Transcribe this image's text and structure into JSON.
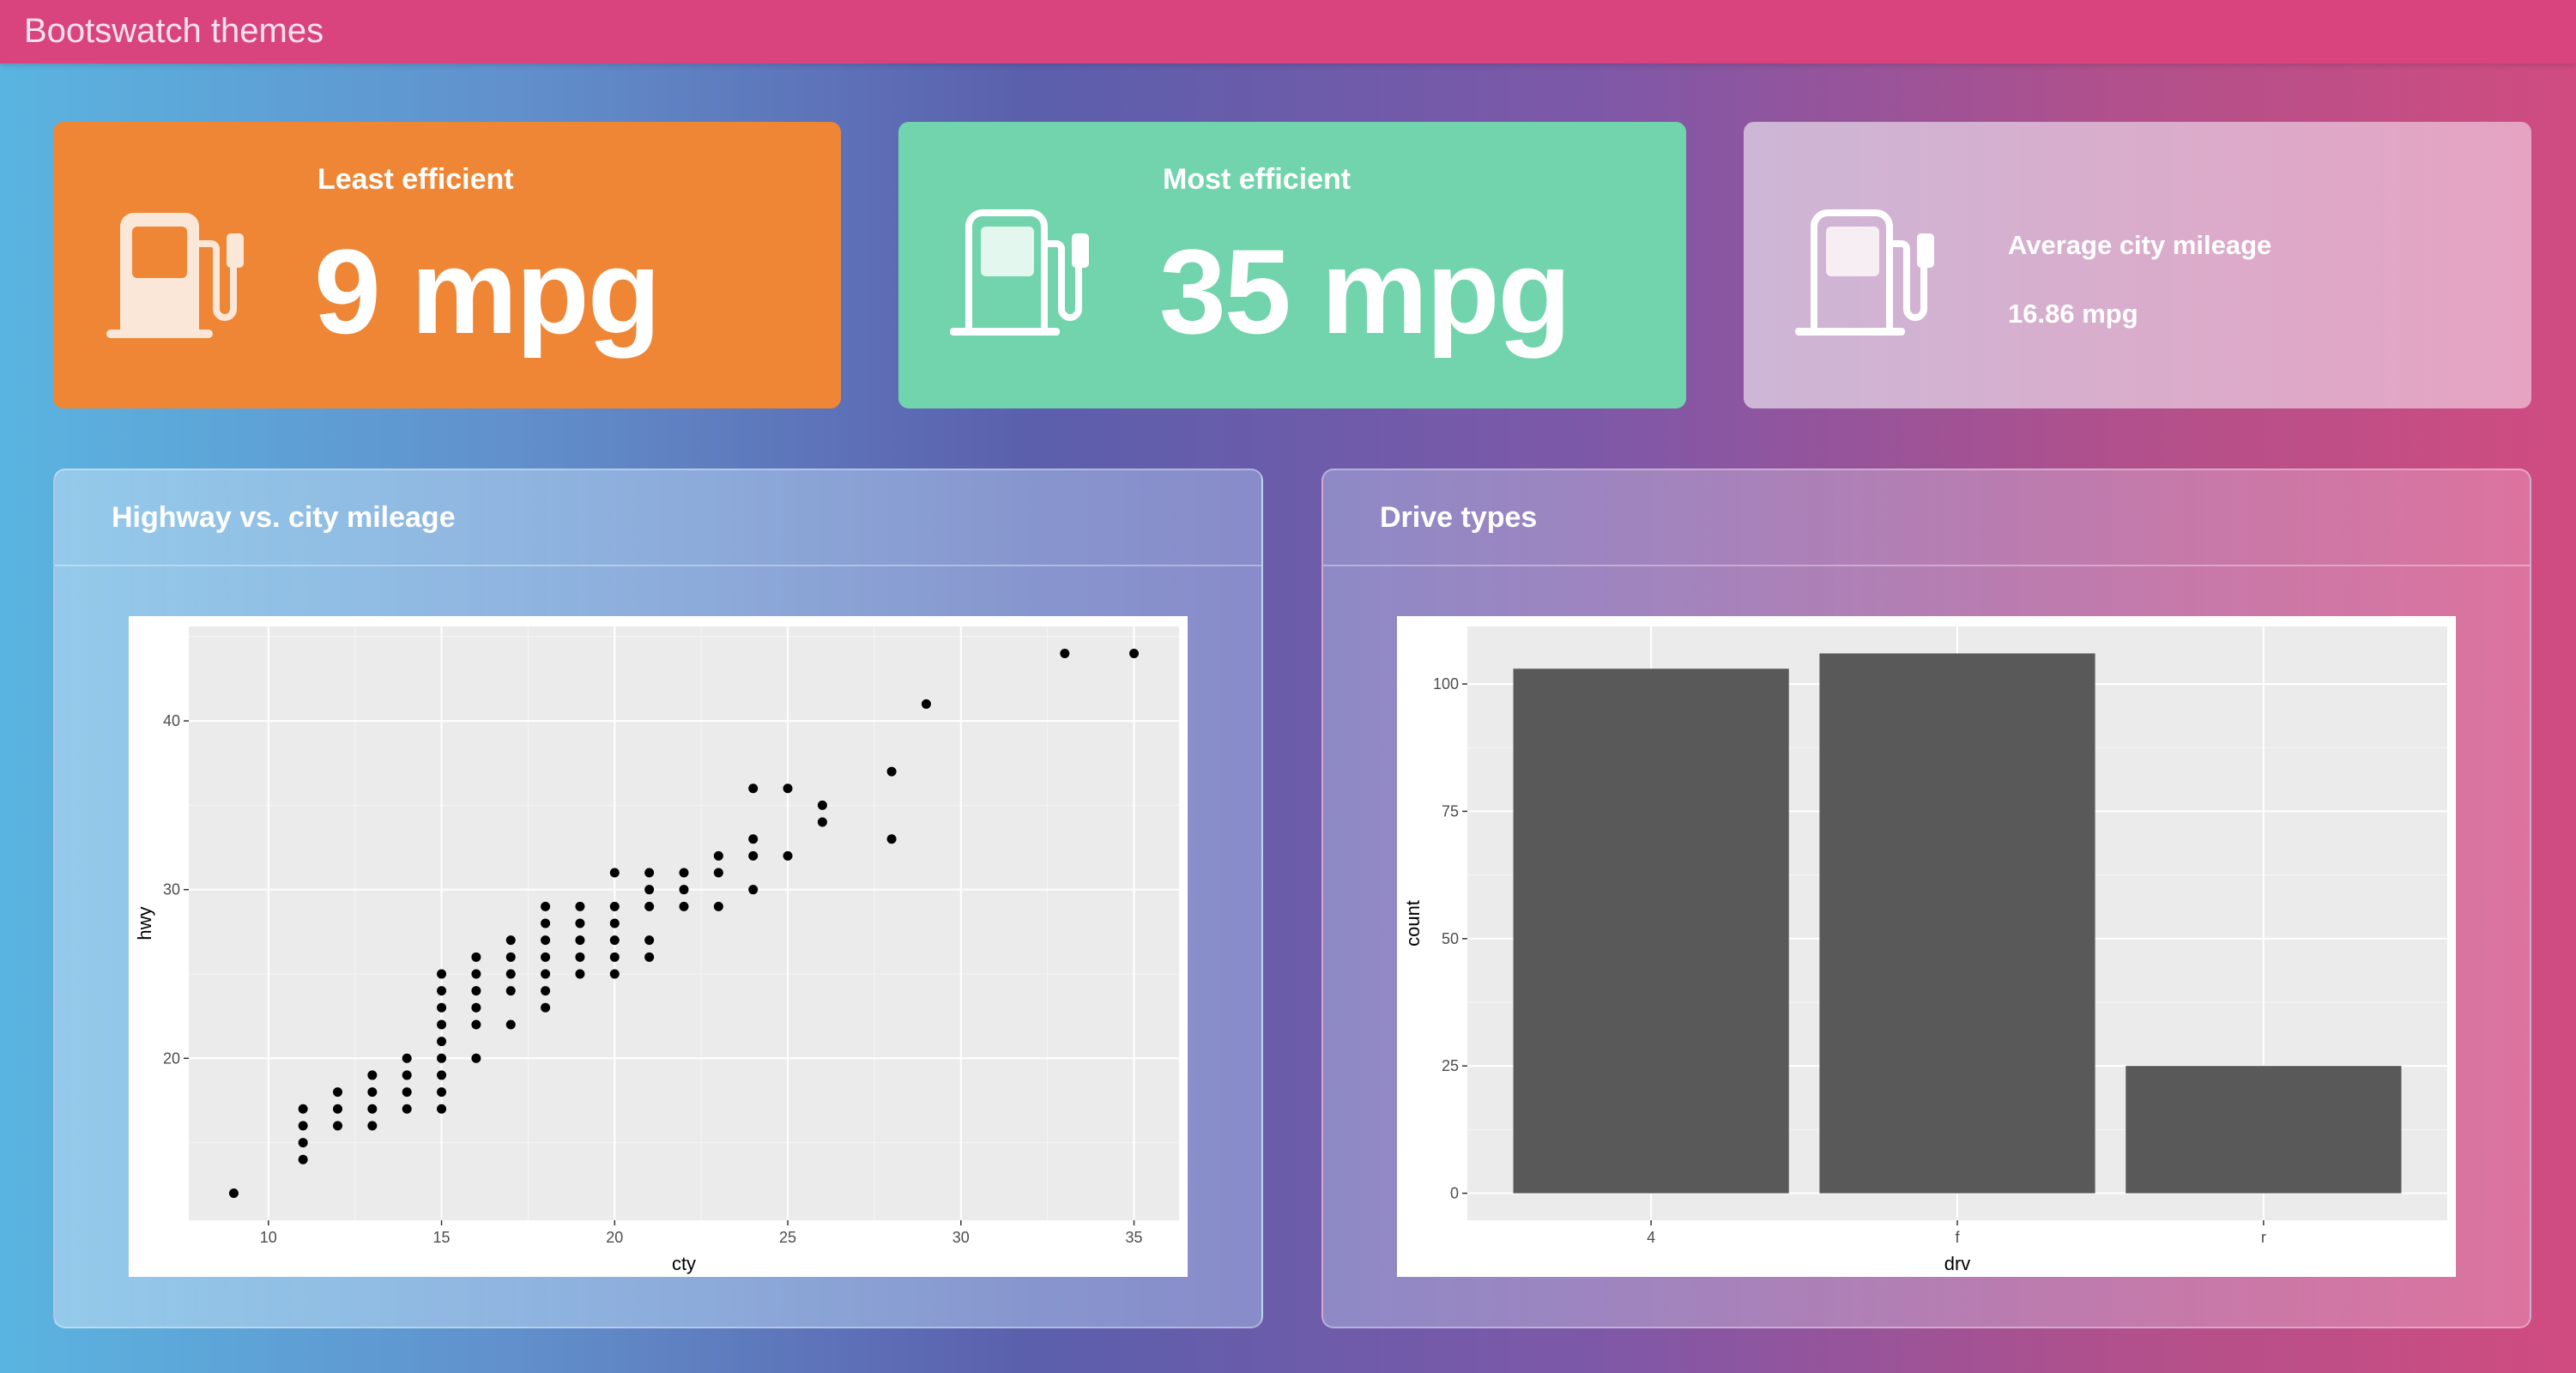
{
  "navbar": {
    "title": "Bootswatch themes"
  },
  "value_boxes": [
    {
      "title": "Least efficient",
      "value": "9 mpg",
      "icon": "fuel-pump-icon",
      "color": "#ef8636"
    },
    {
      "title": "Most efficient",
      "value": "35 mpg",
      "icon": "fuel-pump-icon",
      "color": "#72d4ac"
    },
    {
      "title": "Average city mileage",
      "value": "16.86 mpg",
      "icon": "fuel-pump-icon",
      "color": "#d9b0cc"
    }
  ],
  "cards": [
    {
      "title": "Highway vs. city mileage"
    },
    {
      "title": "Drive types"
    }
  ],
  "chart_data": [
    {
      "type": "scatter",
      "title": "",
      "xlabel": "cty",
      "ylabel": "hwy",
      "xlim": [
        7.7,
        36.3
      ],
      "ylim": [
        10.4,
        45.6
      ],
      "x_ticks": [
        10,
        15,
        20,
        25,
        30,
        35
      ],
      "y_ticks": [
        20,
        30,
        40
      ],
      "grid": true,
      "points": [
        [
          9,
          12
        ],
        [
          11,
          14
        ],
        [
          11,
          15
        ],
        [
          11,
          16
        ],
        [
          11,
          17
        ],
        [
          12,
          16
        ],
        [
          12,
          17
        ],
        [
          12,
          18
        ],
        [
          13,
          16
        ],
        [
          13,
          17
        ],
        [
          13,
          18
        ],
        [
          13,
          19
        ],
        [
          14,
          17
        ],
        [
          14,
          18
        ],
        [
          14,
          19
        ],
        [
          14,
          20
        ],
        [
          15,
          17
        ],
        [
          15,
          18
        ],
        [
          15,
          19
        ],
        [
          15,
          20
        ],
        [
          15,
          21
        ],
        [
          15,
          22
        ],
        [
          15,
          23
        ],
        [
          15,
          24
        ],
        [
          15,
          25
        ],
        [
          16,
          20
        ],
        [
          16,
          22
        ],
        [
          16,
          23
        ],
        [
          16,
          24
        ],
        [
          16,
          25
        ],
        [
          16,
          26
        ],
        [
          17,
          22
        ],
        [
          17,
          24
        ],
        [
          17,
          25
        ],
        [
          17,
          26
        ],
        [
          17,
          27
        ],
        [
          18,
          23
        ],
        [
          18,
          24
        ],
        [
          18,
          25
        ],
        [
          18,
          26
        ],
        [
          18,
          27
        ],
        [
          18,
          28
        ],
        [
          18,
          29
        ],
        [
          19,
          25
        ],
        [
          19,
          26
        ],
        [
          19,
          27
        ],
        [
          19,
          28
        ],
        [
          19,
          29
        ],
        [
          20,
          25
        ],
        [
          20,
          26
        ],
        [
          20,
          27
        ],
        [
          20,
          28
        ],
        [
          20,
          29
        ],
        [
          20,
          31
        ],
        [
          21,
          26
        ],
        [
          21,
          27
        ],
        [
          21,
          29
        ],
        [
          21,
          30
        ],
        [
          21,
          31
        ],
        [
          22,
          29
        ],
        [
          22,
          30
        ],
        [
          22,
          31
        ],
        [
          23,
          29
        ],
        [
          23,
          31
        ],
        [
          23,
          32
        ],
        [
          24,
          30
        ],
        [
          24,
          32
        ],
        [
          24,
          33
        ],
        [
          24,
          36
        ],
        [
          25,
          32
        ],
        [
          25,
          36
        ],
        [
          26,
          34
        ],
        [
          26,
          35
        ],
        [
          28,
          33
        ],
        [
          28,
          37
        ],
        [
          29,
          41
        ],
        [
          33,
          44
        ],
        [
          35,
          44
        ]
      ]
    },
    {
      "type": "bar",
      "title": "",
      "xlabel": "drv",
      "ylabel": "count",
      "categories": [
        "4",
        "f",
        "r"
      ],
      "values": [
        103,
        106,
        25
      ],
      "ylim": [
        -5.3,
        111.3
      ],
      "y_ticks": [
        0,
        25,
        50,
        75,
        100
      ],
      "grid": true,
      "bar_color": "#595959"
    }
  ]
}
